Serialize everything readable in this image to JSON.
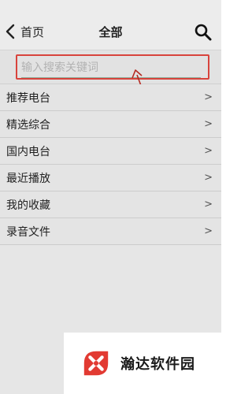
{
  "header": {
    "back_icon": "chevron-left-icon",
    "back_label": "首页",
    "title": "全部",
    "search_icon": "magnifier-icon"
  },
  "search": {
    "placeholder": "输入搜索关键词",
    "value": ""
  },
  "menu": {
    "items": [
      {
        "label": "推荐电台",
        "chevron": ">"
      },
      {
        "label": "精选综合",
        "chevron": ">"
      },
      {
        "label": "国内电台",
        "chevron": ">"
      },
      {
        "label": "最近播放",
        "chevron": ">"
      },
      {
        "label": "我的收藏",
        "chevron": ">"
      },
      {
        "label": "录音文件",
        "chevron": ">"
      }
    ]
  },
  "annotation": {
    "color": "#d8433c"
  },
  "watermark": {
    "text": "瀚达软件园",
    "logo_icon": "brand-logo-icon"
  }
}
